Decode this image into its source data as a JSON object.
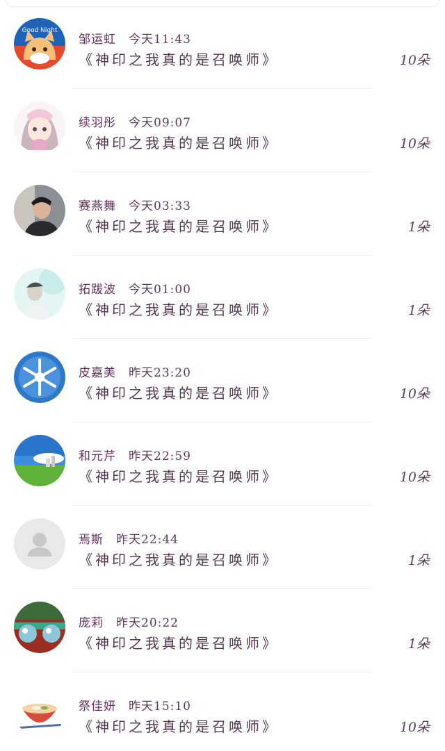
{
  "entries": [
    {
      "name": "邹运虹",
      "time": "今天11:43",
      "title": "《神印之我真的是召唤师》",
      "count": "10朵",
      "avatar": "cat-cartoon"
    },
    {
      "name": "续羽彤",
      "time": "今天09:07",
      "title": "《神印之我真的是召唤师》",
      "count": "10朵",
      "avatar": "anime-girl"
    },
    {
      "name": "赛燕舞",
      "time": "今天03:33",
      "title": "《神印之我真的是召唤师》",
      "count": "1朵",
      "avatar": "man-photo"
    },
    {
      "name": "拓跋波",
      "time": "今天01:00",
      "title": "《神印之我真的是召唤师》",
      "count": "1朵",
      "avatar": "teal-portrait"
    },
    {
      "name": "皮嘉美",
      "time": "昨天23:20",
      "title": "《神印之我真的是召唤师》",
      "count": "10朵",
      "avatar": "snowflake"
    },
    {
      "name": "和元芹",
      "time": "昨天22:59",
      "title": "《神印之我真的是召唤师》",
      "count": "10朵",
      "avatar": "landscape"
    },
    {
      "name": "焉斯",
      "time": "昨天22:44",
      "title": "《神印之我真的是召唤师》",
      "count": "1朵",
      "avatar": "default-user"
    },
    {
      "name": "庞莉",
      "time": "昨天20:22",
      "title": "《神印之我真的是召唤师》",
      "count": "1朵",
      "avatar": "glass-spheres"
    },
    {
      "name": "祭佳妍",
      "time": "昨天15:10",
      "title": "《神印之我真的是召唤师》",
      "count": "10朵",
      "avatar": "noodle-bowl"
    }
  ]
}
